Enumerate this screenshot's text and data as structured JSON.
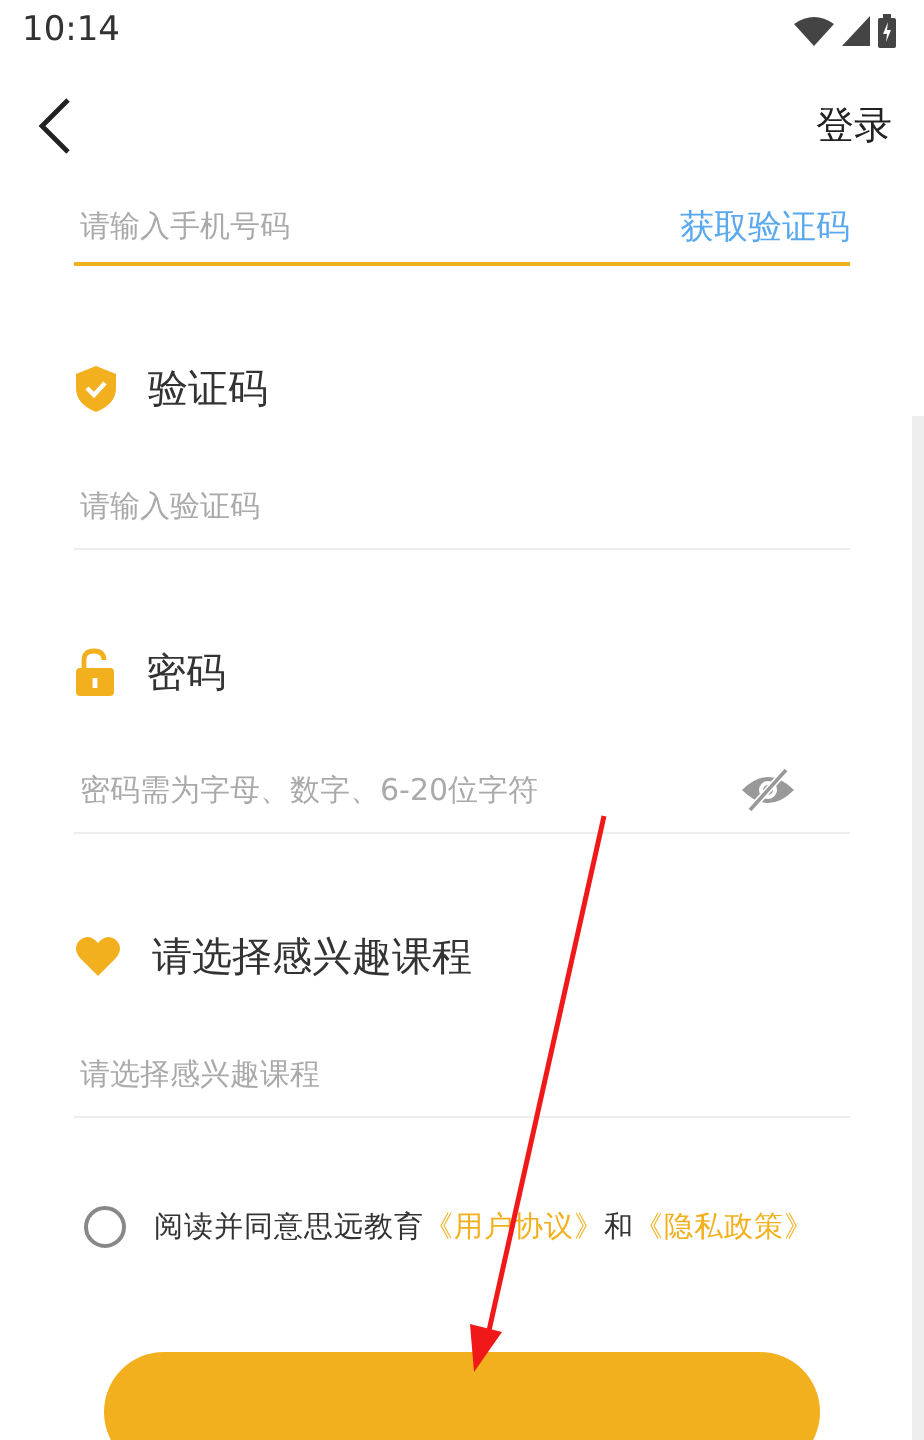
{
  "status_bar": {
    "time": "10:14"
  },
  "nav": {
    "action": "登录"
  },
  "phone": {
    "placeholder": "请输入手机号码",
    "code_button": "获取验证码"
  },
  "sections": [
    {
      "kind": "code",
      "title": "验证码",
      "placeholder": "请输入验证码"
    },
    {
      "kind": "password",
      "title": "密码",
      "placeholder": "密码需为字母、数字、6-20位字符",
      "password_visible": false
    },
    {
      "kind": "interest",
      "title": "请选择感兴趣课程",
      "placeholder": "请选择感兴趣课程"
    }
  ],
  "agreement": {
    "checked": false,
    "parts": [
      {
        "kind": "text",
        "text": "阅读并同意思远教育"
      },
      {
        "kind": "link",
        "text": "《用户协议》"
      },
      {
        "kind": "text",
        "text": "和"
      },
      {
        "kind": "link",
        "text": "《隐私政策》"
      }
    ]
  }
}
